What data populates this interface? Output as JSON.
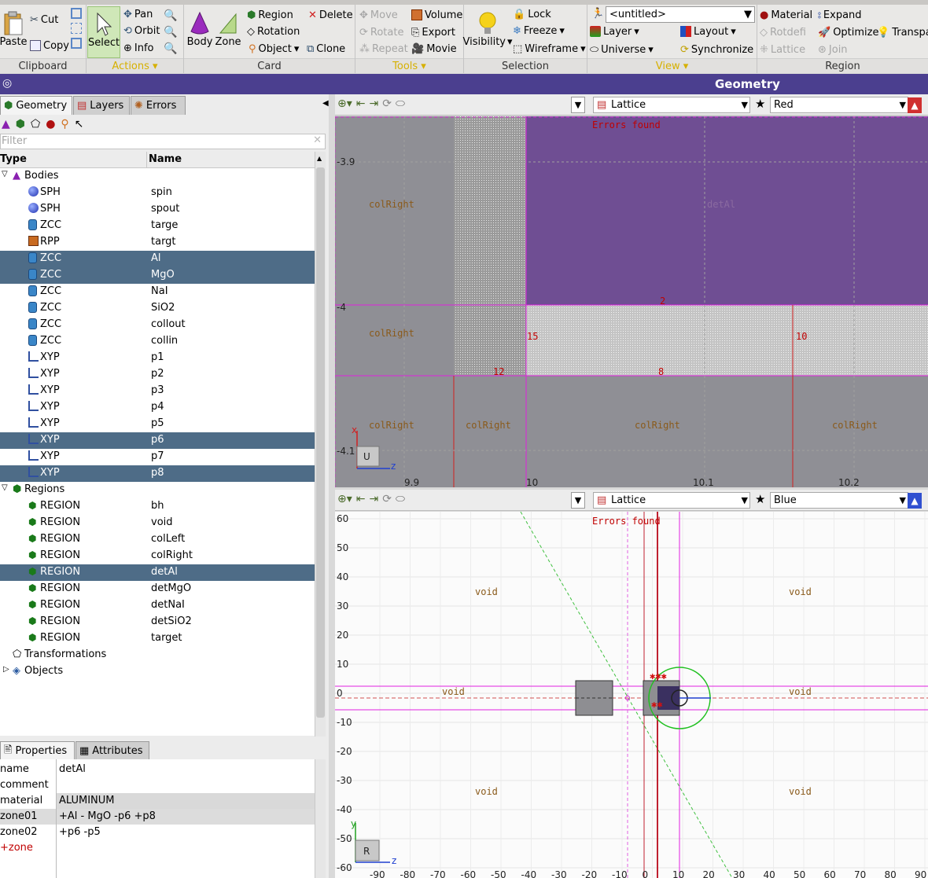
{
  "ribbon": {
    "clipboard": {
      "paste": "Paste",
      "cut": "Cut",
      "copy": "Copy",
      "group": "Clipboard"
    },
    "actions": {
      "select": "Select",
      "pan": "Pan",
      "orbit": "Orbit",
      "info": "Info",
      "group": "Actions"
    },
    "card": {
      "body": "Body",
      "zone": "Zone",
      "region": "Region",
      "rotation": "Rotation",
      "object": "Object",
      "delete": "Delete",
      "clone": "Clone",
      "group": "Card"
    },
    "tools": {
      "move": "Move",
      "rotate": "Rotate",
      "repeat": "Repeat",
      "volume": "Volume",
      "export": "Export",
      "movie": "Movie",
      "group": "Tools"
    },
    "selection": {
      "visibility": "Visibility",
      "lock": "Lock",
      "freeze": "Freeze",
      "wireframe": "Wireframe",
      "group": "Selection"
    },
    "view": {
      "untitled": "<untitled>",
      "layer": "Layer",
      "layout": "Layout",
      "universe": "Universe",
      "synchronize": "Synchronize",
      "group": "View"
    },
    "region": {
      "material": "Material",
      "expand": "Expand",
      "rotdefi": "Rotdefi",
      "optimize": "Optimize",
      "transparency": "Transpa",
      "lattice": "Lattice",
      "join": "Join",
      "group": "Region"
    }
  },
  "title": "Geometry",
  "left_tabs": {
    "geometry": "Geometry",
    "layers": "Layers",
    "errors": "Errors"
  },
  "filter_placeholder": "Filter",
  "tree_headers": {
    "type": "Type",
    "name": "Name"
  },
  "tree": {
    "bodies_label": "Bodies",
    "bodies": [
      {
        "type": "SPH",
        "name": "spin",
        "sel": false
      },
      {
        "type": "SPH",
        "name": "spout",
        "sel": false
      },
      {
        "type": "ZCC",
        "name": "targe",
        "sel": false
      },
      {
        "type": "RPP",
        "name": "targt",
        "sel": false
      },
      {
        "type": "ZCC",
        "name": "Al",
        "sel": true
      },
      {
        "type": "ZCC",
        "name": "MgO",
        "sel": true
      },
      {
        "type": "ZCC",
        "name": "NaI",
        "sel": false
      },
      {
        "type": "ZCC",
        "name": "SiO2",
        "sel": false
      },
      {
        "type": "ZCC",
        "name": "collout",
        "sel": false
      },
      {
        "type": "ZCC",
        "name": "collin",
        "sel": false
      },
      {
        "type": "XYP",
        "name": "p1",
        "sel": false
      },
      {
        "type": "XYP",
        "name": "p2",
        "sel": false
      },
      {
        "type": "XYP",
        "name": "p3",
        "sel": false
      },
      {
        "type": "XYP",
        "name": "p4",
        "sel": false
      },
      {
        "type": "XYP",
        "name": "p5",
        "sel": false
      },
      {
        "type": "XYP",
        "name": "p6",
        "sel": true
      },
      {
        "type": "XYP",
        "name": "p7",
        "sel": false
      },
      {
        "type": "XYP",
        "name": "p8",
        "sel": true
      }
    ],
    "regions_label": "Regions",
    "regions": [
      {
        "type": "REGION",
        "name": "bh",
        "sel": false
      },
      {
        "type": "REGION",
        "name": "void",
        "sel": false
      },
      {
        "type": "REGION",
        "name": "colLeft",
        "sel": false
      },
      {
        "type": "REGION",
        "name": "colRight",
        "sel": false
      },
      {
        "type": "REGION",
        "name": "detAl",
        "sel": true
      },
      {
        "type": "REGION",
        "name": "detMgO",
        "sel": false
      },
      {
        "type": "REGION",
        "name": "detNaI",
        "sel": false
      },
      {
        "type": "REGION",
        "name": "detSiO2",
        "sel": false
      },
      {
        "type": "REGION",
        "name": "target",
        "sel": false
      }
    ],
    "transformations_label": "Transformations",
    "objects_label": "Objects"
  },
  "prop_tabs": {
    "properties": "Properties",
    "attributes": "Attributes"
  },
  "properties": [
    {
      "key": "name",
      "value": "detAl"
    },
    {
      "key": "comment",
      "value": ""
    },
    {
      "key": "material",
      "value": "ALUMINUM"
    },
    {
      "key": "zone01",
      "value": "+Al - MgO -p6 +p8"
    },
    {
      "key": "zone02",
      "value": "+p6 -p5"
    },
    {
      "key": "+zone",
      "value": ""
    }
  ],
  "view_top": {
    "lattice": "Lattice",
    "color": "Red",
    "errors": "Errors found",
    "region_labels": [
      "colRight",
      "detAl",
      "colRight",
      "colRight",
      "colRight",
      "colRight",
      "colRight"
    ],
    "y_ticks": [
      "-3.9",
      "-4",
      "-4.1"
    ],
    "x_ticks": [
      "9.9",
      "10",
      "10.1",
      "10.2"
    ],
    "markers": [
      "2",
      "15",
      "10",
      "12",
      "8"
    ],
    "axis_badge": "U",
    "z": "z",
    "x": "x"
  },
  "view_bottom": {
    "lattice": "Lattice",
    "color": "Blue",
    "errors": "Errors found",
    "region_labels": [
      "void",
      "void",
      "void",
      "void",
      "void",
      "void"
    ],
    "y_ticks": [
      "60",
      "50",
      "40",
      "30",
      "20",
      "10",
      "0",
      "-10",
      "-20",
      "-30",
      "-40",
      "-50",
      "-60"
    ],
    "x_ticks": [
      "-90",
      "-80",
      "-70",
      "-60",
      "-50",
      "-40",
      "-30",
      "-20",
      "-10",
      "0",
      "10",
      "20",
      "30",
      "40",
      "50",
      "60",
      "70",
      "80",
      "90"
    ],
    "axis_badge": "R",
    "y": "y",
    "z": "z"
  }
}
